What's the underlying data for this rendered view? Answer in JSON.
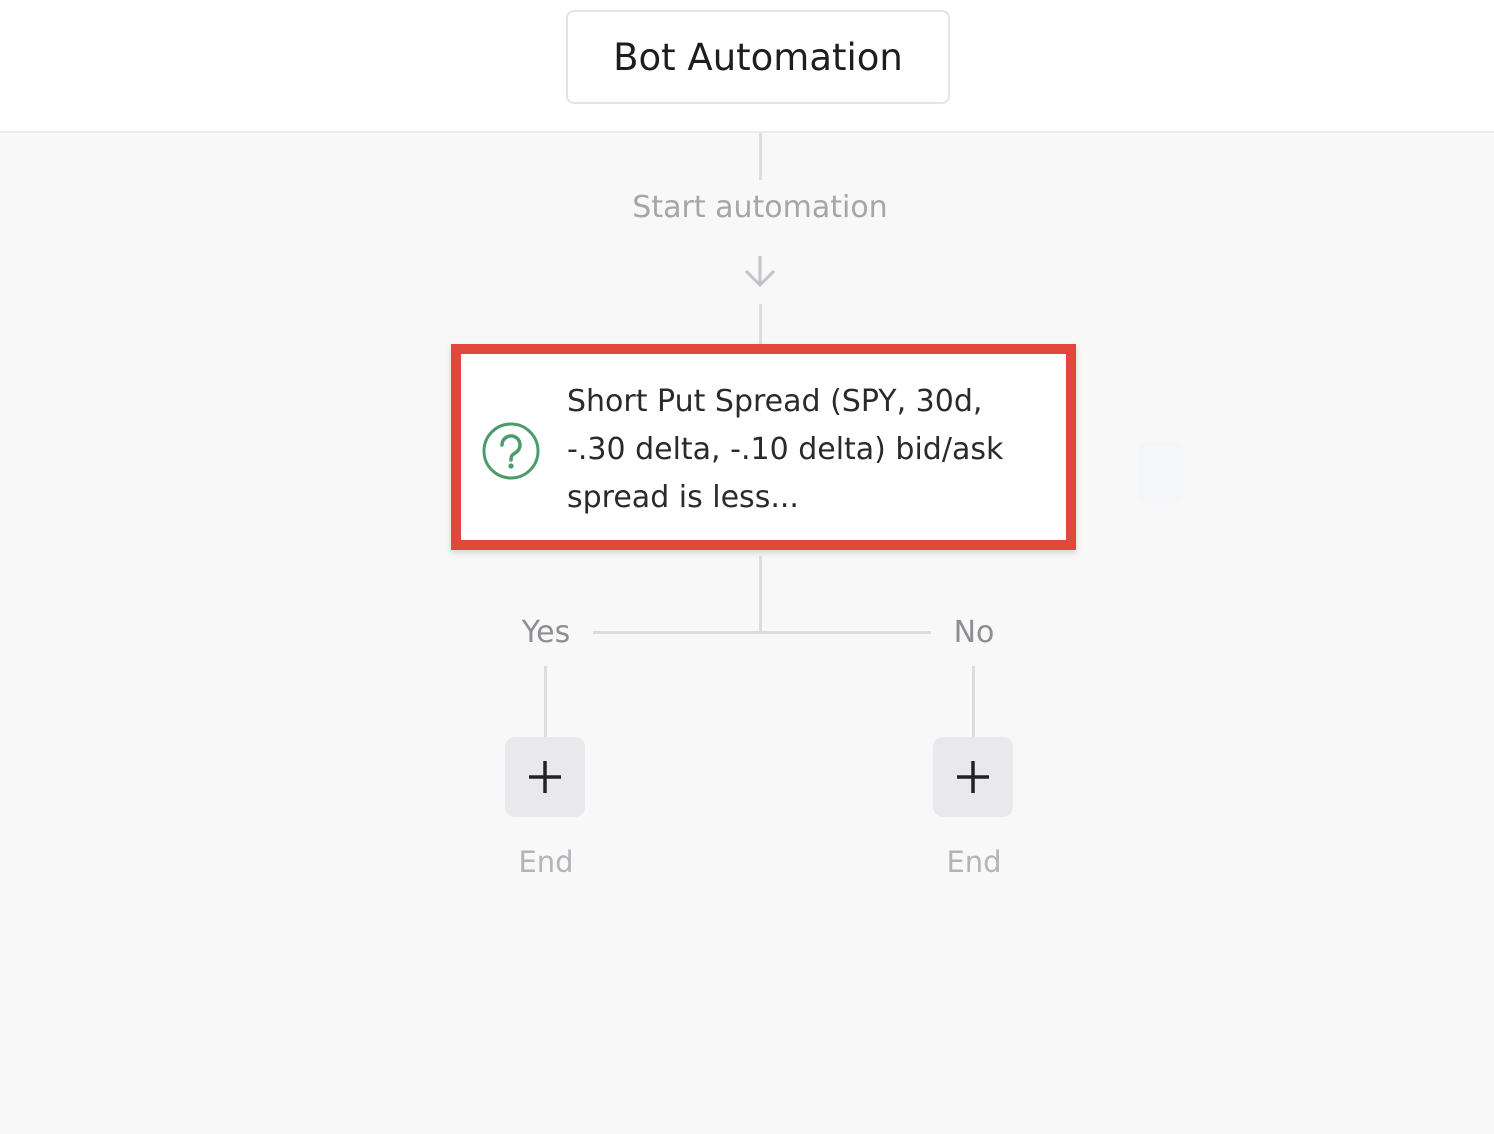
{
  "header": {
    "title": "Bot Automation"
  },
  "flow": {
    "start_label": "Start automation",
    "condition": {
      "text": "Short Put Spread (SPY, 30d,\n-.30 delta, -.10 delta) bid/ask\nspread is less...",
      "icon": "question-circle-icon",
      "highlight_color": "#e0483c",
      "icon_color": "#4a9d6b"
    },
    "branches": [
      {
        "label": "Yes",
        "end_label": "End",
        "add_icon": "plus-icon"
      },
      {
        "label": "No",
        "end_label": "End",
        "add_icon": "plus-icon"
      }
    ]
  }
}
